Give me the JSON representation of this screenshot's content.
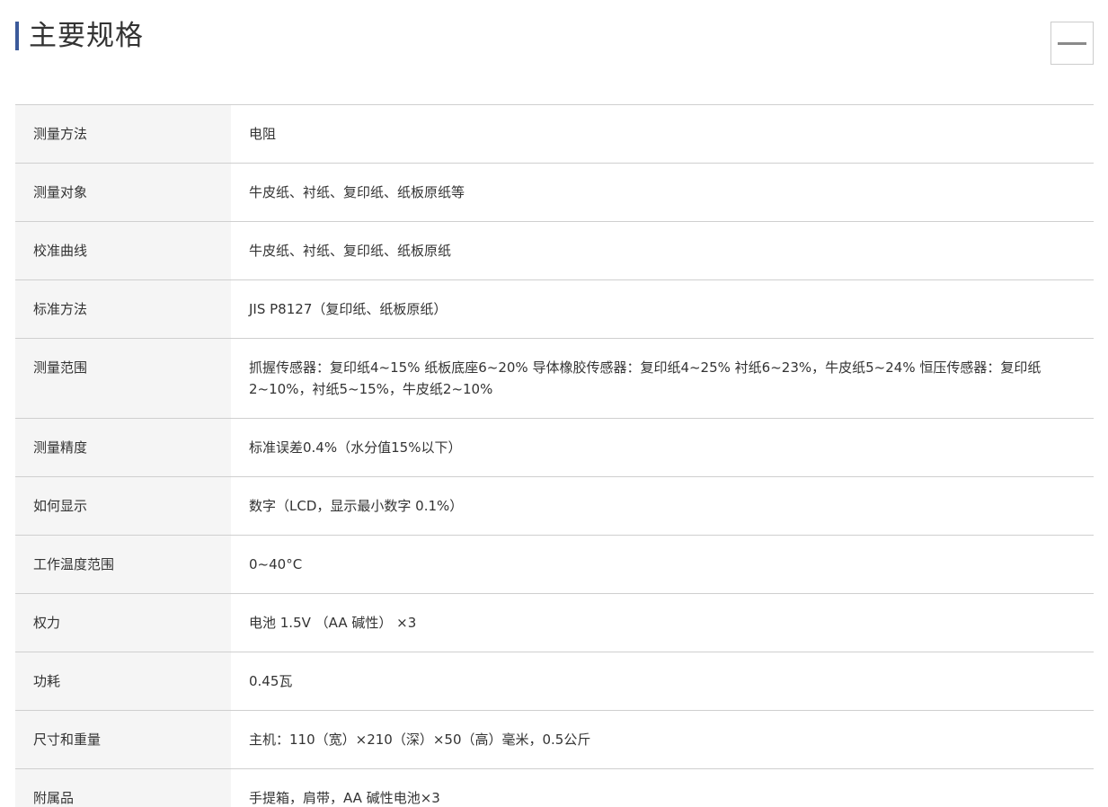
{
  "section": {
    "title": "主要规格"
  },
  "specs": [
    {
      "label": "测量方法",
      "value": "电阻"
    },
    {
      "label": "测量对象",
      "value": "牛皮纸、衬纸、复印纸、纸板原纸等"
    },
    {
      "label": "校准曲线",
      "value": "牛皮纸、衬纸、复印纸、纸板原纸"
    },
    {
      "label": "标准方法",
      "value": "JIS P8127（复印纸、纸板原纸）"
    },
    {
      "label": "测量范围",
      "value": "抓握传感器：复印纸4~15% 纸板底座6~20% 导体橡胶传感器：复印纸4~25% 衬纸6~23%，牛皮纸5~24% 恒压传感器：复印纸2~10%，衬纸5~15%，牛皮纸2~10%"
    },
    {
      "label": "测量精度",
      "value": "标准误差0.4%（水分值15%以下）"
    },
    {
      "label": "如何显示",
      "value": "数字（LCD，显示最小数字 0.1%）"
    },
    {
      "label": "工作温度范围",
      "value": "0~40°C"
    },
    {
      "label": "权力",
      "value": "电池 1.5V （AA 碱性） ×3"
    },
    {
      "label": "功耗",
      "value": "0.45瓦"
    },
    {
      "label": "尺寸和重量",
      "value": "主机：110（宽）×210（深）×50（高）毫米，0.5公斤"
    },
    {
      "label": "附属品",
      "value": "手提箱，肩带，AA 碱性电池×3"
    }
  ]
}
